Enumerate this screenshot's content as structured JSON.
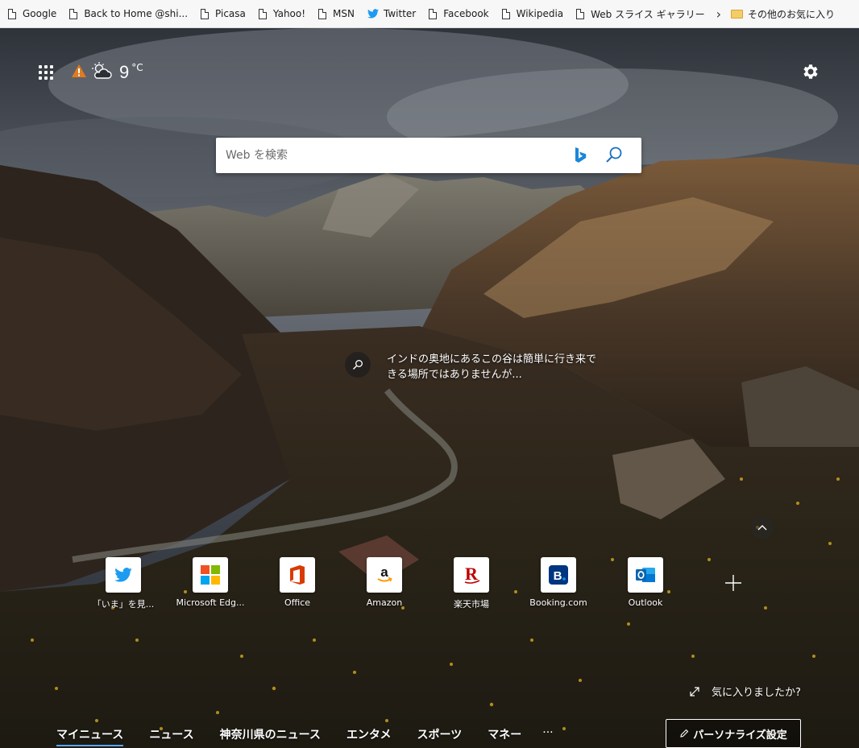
{
  "favorites_bar": {
    "items": [
      {
        "label": "Google",
        "icon": "page-icon"
      },
      {
        "label": "Back to Home @shi...",
        "icon": "page-icon"
      },
      {
        "label": "Picasa",
        "icon": "page-icon"
      },
      {
        "label": "Yahoo!",
        "icon": "page-icon"
      },
      {
        "label": "MSN",
        "icon": "page-icon"
      },
      {
        "label": "Twitter",
        "icon": "twitter-icon"
      },
      {
        "label": "Facebook",
        "icon": "page-icon"
      },
      {
        "label": "Wikipedia",
        "icon": "page-icon"
      },
      {
        "label": "Web スライス ギャラリー",
        "icon": "page-icon"
      }
    ],
    "other_favorites": "その他のお気に入り"
  },
  "header": {
    "weather": {
      "temperature": "9",
      "unit": "°C",
      "alert_icon": "warning-icon",
      "condition_icon": "partly-cloudy-icon"
    },
    "settings_icon": "gear-icon"
  },
  "search": {
    "placeholder": "Web を検索"
  },
  "image_caption": {
    "text": "インドの奥地にあるこの谷は簡単に行き来できる場所ではありませんが..."
  },
  "quick_links": [
    {
      "label": "「いま」を見...",
      "icon": "twitter-icon"
    },
    {
      "label": "Microsoft Edg...",
      "icon": "microsoft-icon"
    },
    {
      "label": "Office",
      "icon": "office-icon"
    },
    {
      "label": "Amazon",
      "icon": "amazon-icon"
    },
    {
      "label": "楽天市場",
      "icon": "rakuten-icon"
    },
    {
      "label": "Booking.com",
      "icon": "booking-icon"
    },
    {
      "label": "Outlook",
      "icon": "outlook-icon"
    }
  ],
  "feedback": {
    "text": "気に入りましたか?"
  },
  "news_nav": {
    "tabs": [
      "マイニュース",
      "ニュース",
      "神奈川県のニュース",
      "エンタメ",
      "スポーツ",
      "マネー"
    ],
    "more": "···",
    "personalize": "パーソナライズ設定"
  },
  "colors": {
    "accent": "#5aa6ff",
    "bing": "#1a86d8",
    "twitter": "#1d9bf0",
    "office": "#d83b01",
    "rakuten": "#bf0000",
    "booking": "#003580",
    "outlook": "#0a64ad"
  }
}
